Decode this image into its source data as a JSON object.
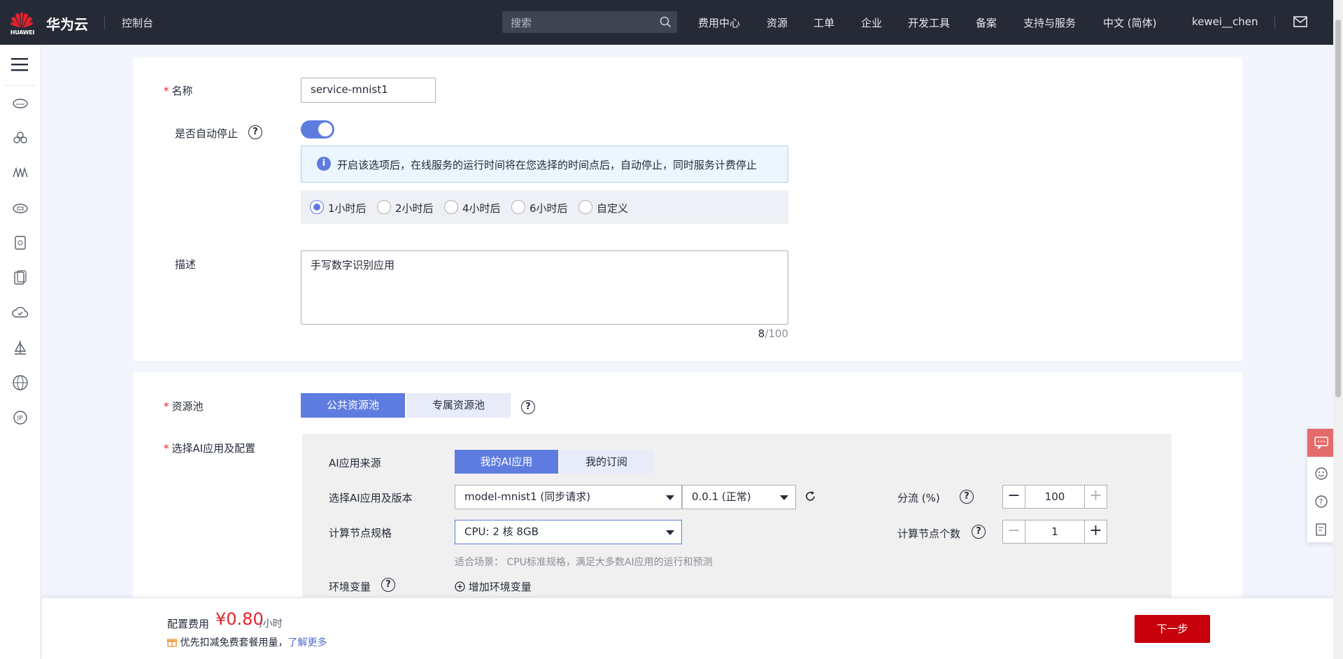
{
  "header": {
    "logo_text": "HUAWEI",
    "brand": "华为云",
    "console": "控制台",
    "search_placeholder": "搜索",
    "nav": [
      "费用中心",
      "资源",
      "工单",
      "企业",
      "开发工具",
      "备案",
      "支持与服务",
      "中文 (简体)",
      "kewei__chen"
    ]
  },
  "form": {
    "name_label": "名称",
    "name_value": "service-mnist1",
    "auto_stop_label": "是否自动停止",
    "auto_stop_on": true,
    "auto_stop_info": "开启该选项后，在线服务的运行时间将在您选择的时间点后，自动停止，同时服务计费停止",
    "auto_stop_options": [
      "1小时后",
      "2小时后",
      "4小时后",
      "6小时后",
      "自定义"
    ],
    "auto_stop_selected": "1小时后",
    "desc_label": "描述",
    "desc_value": "手写数字识别应用",
    "desc_count": "8",
    "desc_max": "/100"
  },
  "resource": {
    "pool_label": "资源池",
    "pool_public": "公共资源池",
    "pool_dedicated": "专属资源池",
    "app_label": "选择AI应用及配置",
    "source_label": "AI应用来源",
    "source_mine": "我的AI应用",
    "source_sub": "我的订阅",
    "version_label": "选择AI应用及版本",
    "app_select": "model-mnist1 (同步请求)",
    "version_select": "0.0.1 (正常)",
    "traffic_label": "分流 (%)",
    "traffic_value": "100",
    "spec_label": "计算节点规格",
    "spec_select": "CPU: 2 核 8GB",
    "nodes_label": "计算节点个数",
    "nodes_value": "1",
    "spec_hint": "适合场景： CPU标准规格，满足大多数AI应用的运行和预测",
    "env_label": "环境变量",
    "env_add": "增加环境变量"
  },
  "footer": {
    "fee_label": "配置费用",
    "price": "¥0.80",
    "unit": "/小时",
    "promo": "优先扣减免费套餐用量，",
    "promo_link": "了解更多",
    "next": "下一步"
  },
  "colors": {
    "brand_red": "#c7000b",
    "accent": "#5e7ce0",
    "topbar": "#252a36"
  }
}
